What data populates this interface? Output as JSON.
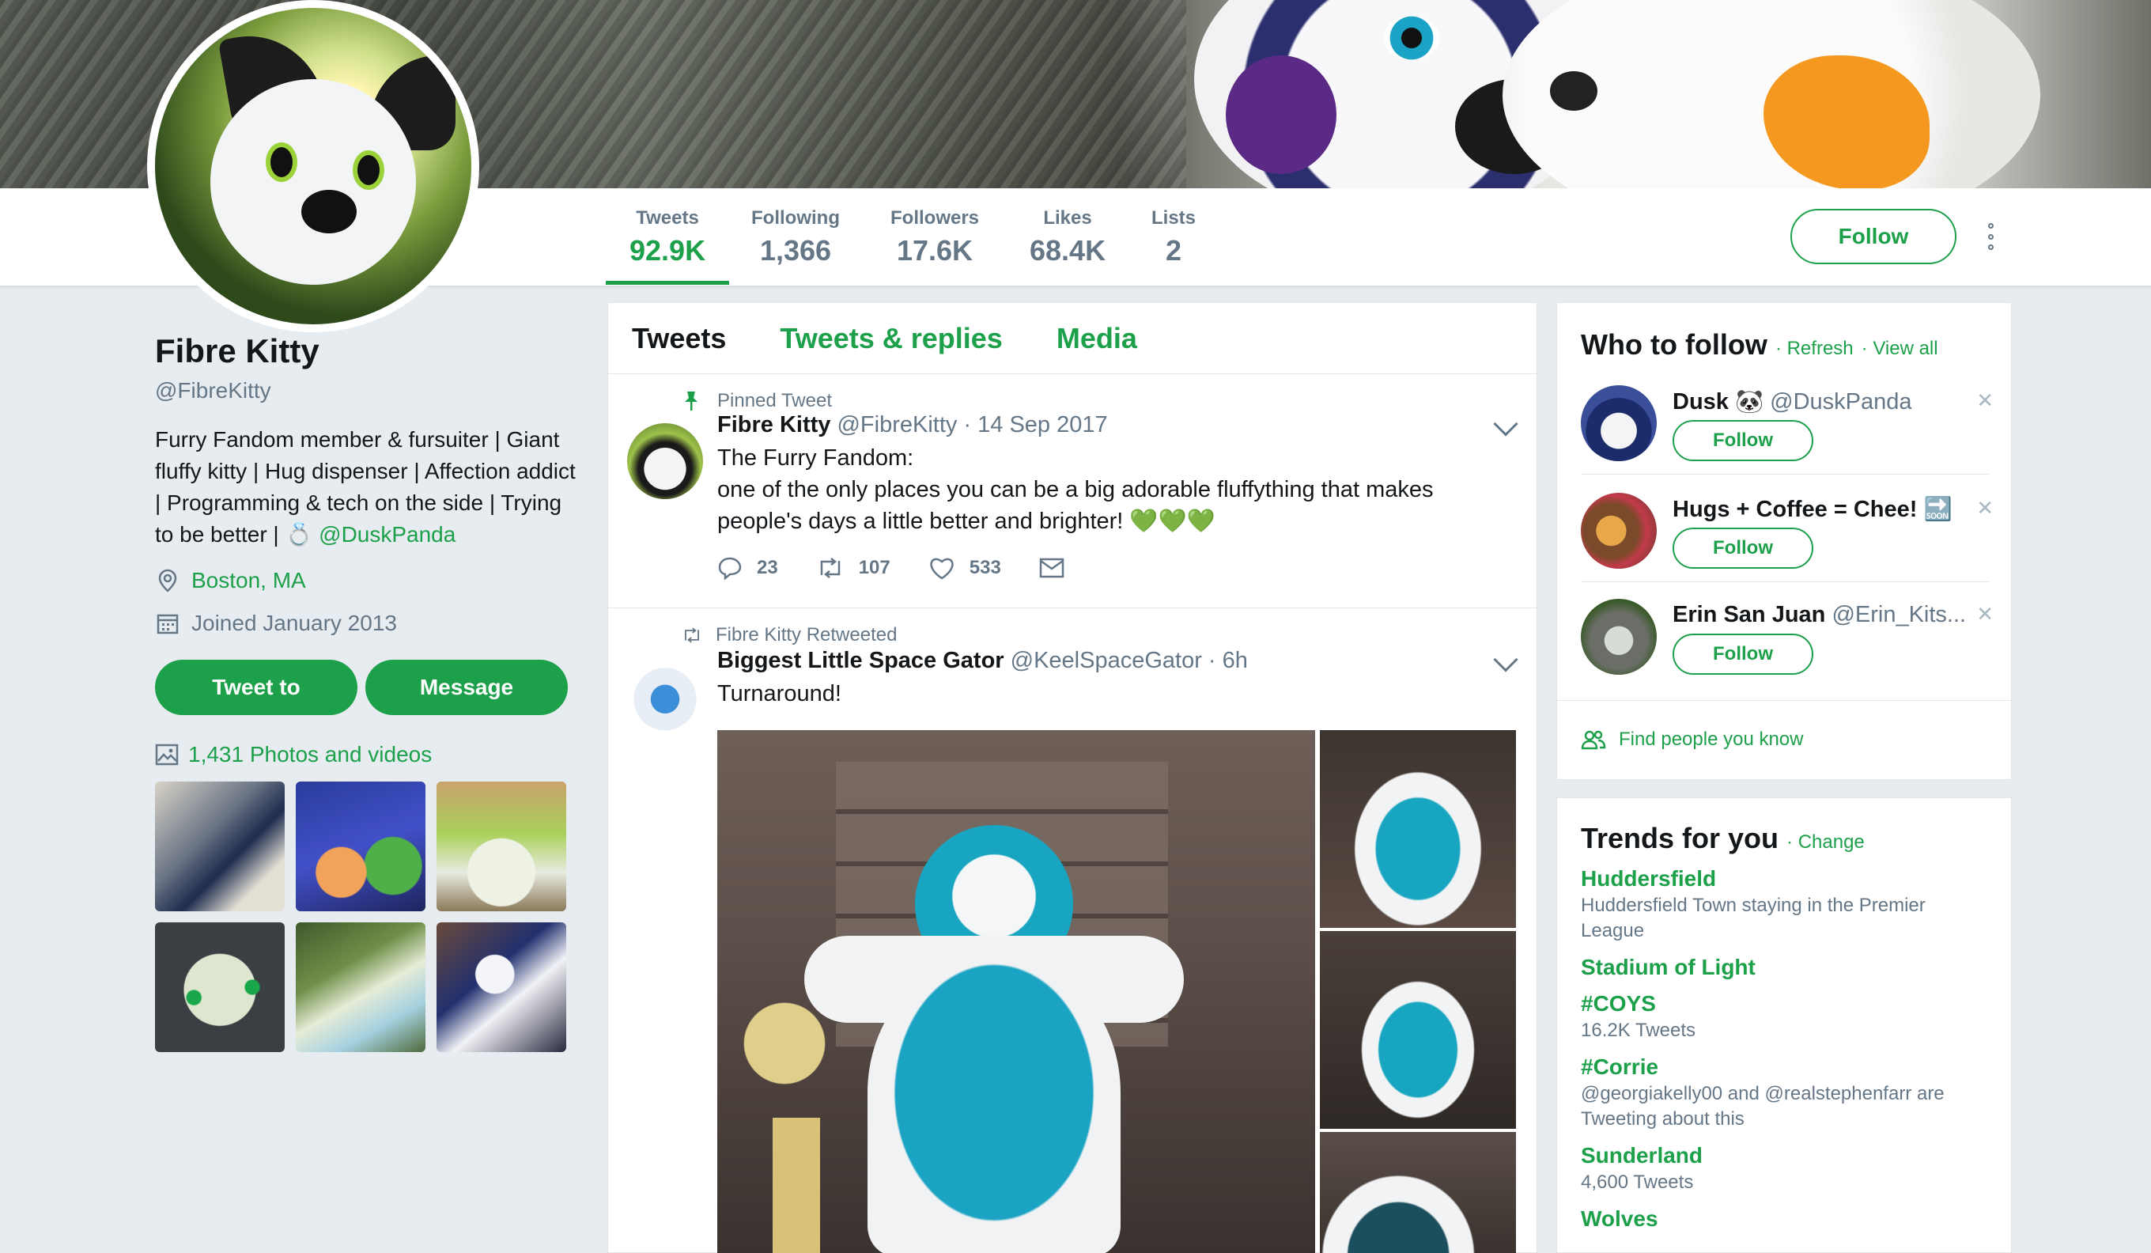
{
  "stats": [
    {
      "label": "Tweets",
      "value": "92.9K"
    },
    {
      "label": "Following",
      "value": "1,366"
    },
    {
      "label": "Followers",
      "value": "17.6K"
    },
    {
      "label": "Likes",
      "value": "68.4K"
    },
    {
      "label": "Lists",
      "value": "2"
    }
  ],
  "header": {
    "follow_label": "Follow"
  },
  "profile": {
    "name": "Fibre Kitty",
    "handle": "@FibreKitty",
    "bio_text": "Furry Fandom member & fursuiter | Giant fluffy kitty | Hug dispenser | Affection addict | Programming & tech on the side | Trying to be better | 💍 ",
    "bio_link": "@DuskPanda",
    "location": "Boston, MA",
    "joined": "Joined January 2013",
    "tweet_to_label": "Tweet to",
    "message_label": "Message",
    "photos_label": "1,431 Photos and videos"
  },
  "tabs": [
    {
      "label": "Tweets"
    },
    {
      "label": "Tweets & replies"
    },
    {
      "label": "Media"
    }
  ],
  "tweets": [
    {
      "context": "Pinned Tweet",
      "name": "Fibre Kitty",
      "handle": "@FibreKitty · 14 Sep 2017",
      "line1": "The Furry Fandom:",
      "line2": "one of the only places you can be a big adorable fluffything that makes people's days a little better and brighter! 💚💚💚",
      "replies": "23",
      "retweets": "107",
      "likes": "533"
    },
    {
      "context": "Fibre Kitty Retweeted",
      "name": "Biggest Little Space Gator",
      "handle": "@KeelSpaceGator · 6h",
      "line1": "Turnaround!"
    }
  ],
  "who_to_follow": {
    "title": "Who to follow",
    "refresh": "· Refresh",
    "view_all": "· View all",
    "users": [
      {
        "name": "Dusk 🐼",
        "handle": "@DuskPanda",
        "follow": "Follow"
      },
      {
        "name": "Hugs + Coffee = Chee! 🔜",
        "handle": "",
        "follow": "Follow"
      },
      {
        "name": "Erin San Juan",
        "handle": "@Erin_Kits...",
        "follow": "Follow"
      }
    ],
    "find_people": "Find people you know"
  },
  "trends": {
    "title": "Trends for you",
    "change": "· Change",
    "items": [
      {
        "name": "Huddersfield",
        "desc": "Huddersfield Town staying in the Premier League"
      },
      {
        "name": "Stadium of Light",
        "desc": ""
      },
      {
        "name": "#COYS",
        "desc": "16.2K Tweets"
      },
      {
        "name": "#Corrie",
        "desc": "@georgiakelly00 and @realstephenfarr are Tweeting about this"
      },
      {
        "name": "Sunderland",
        "desc": "4,600 Tweets"
      },
      {
        "name": "Wolves",
        "desc": ""
      }
    ]
  },
  "colors": {
    "accent": "#1da04a",
    "muted": "#657786",
    "background": "#e6ecf0"
  }
}
